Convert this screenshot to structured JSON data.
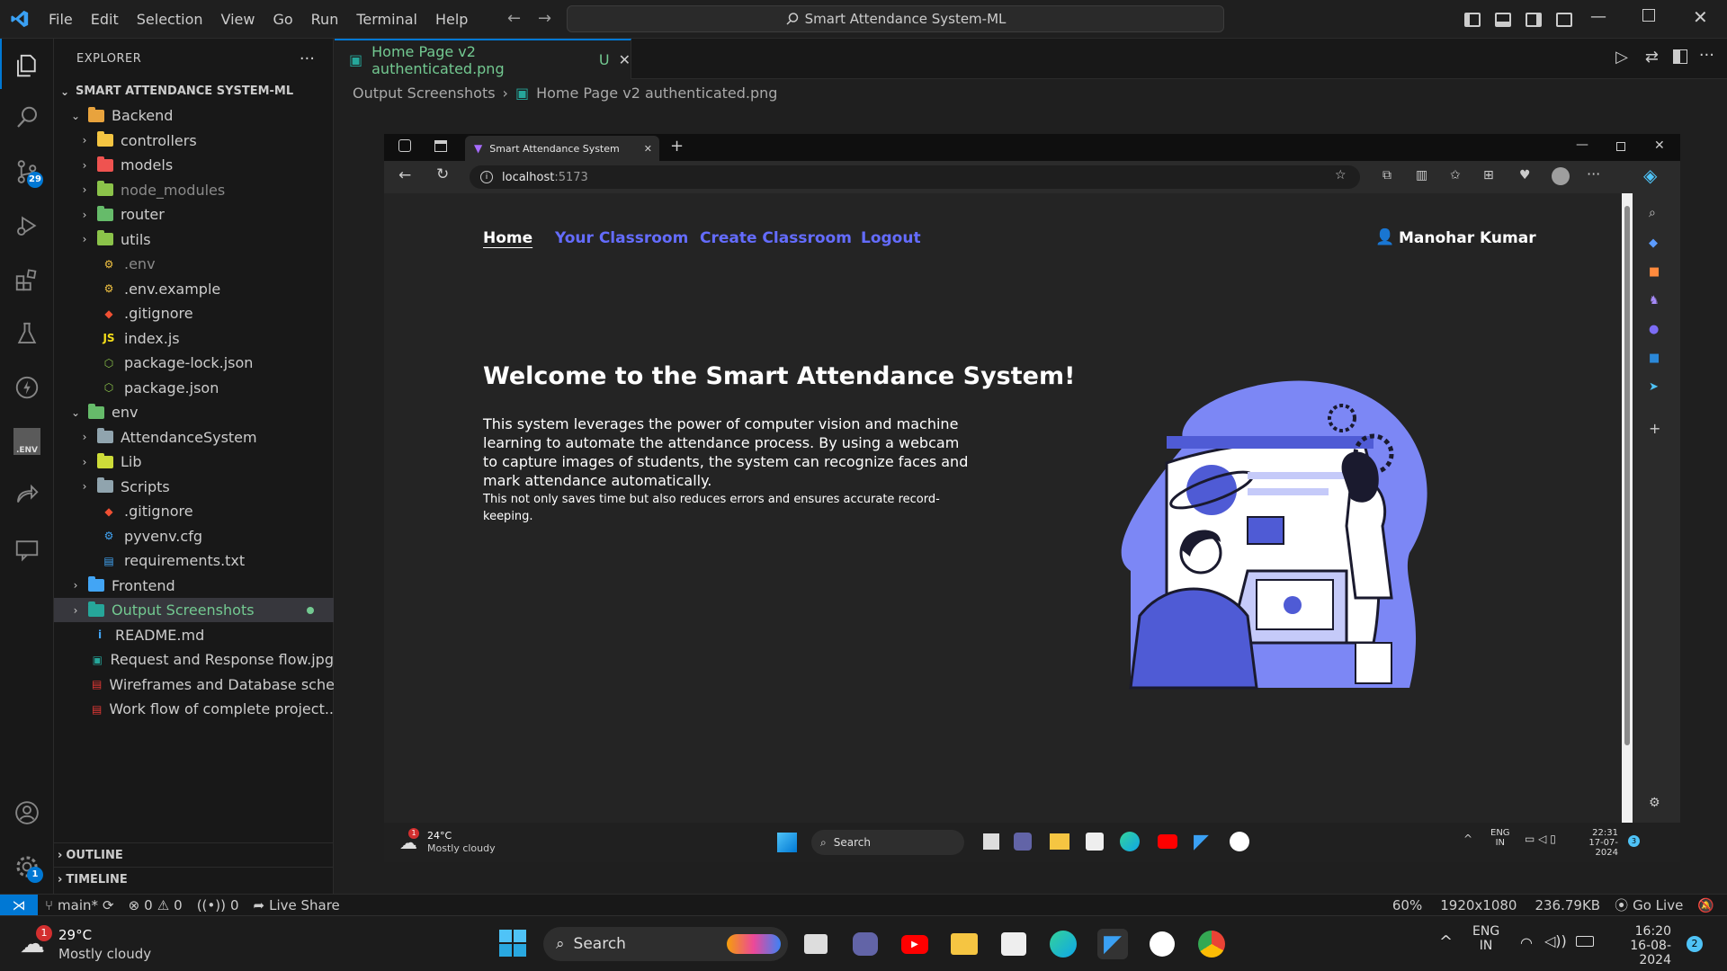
{
  "titlebar": {
    "menus": [
      "File",
      "Edit",
      "Selection",
      "View",
      "Go",
      "Run",
      "Terminal",
      "Help"
    ],
    "search_text": "Smart Attendance System-ML"
  },
  "activity": {
    "source_control_badge": "29",
    "accounts_badge": "1"
  },
  "sidebar": {
    "header": "EXPLORER",
    "root": "SMART ATTENDANCE SYSTEM-ML",
    "items": [
      {
        "label": "Backend",
        "level": 1,
        "kind": "folder-open",
        "color": "#e8a33d"
      },
      {
        "label": "controllers",
        "level": 2,
        "kind": "folder",
        "color": "#f5c542"
      },
      {
        "label": "models",
        "level": 2,
        "kind": "folder",
        "color": "#ef5350"
      },
      {
        "label": "node_modules",
        "level": 2,
        "kind": "folder",
        "color": "#8bc34a",
        "dim": true
      },
      {
        "label": "router",
        "level": 2,
        "kind": "folder",
        "color": "#66bb6a"
      },
      {
        "label": "utils",
        "level": 2,
        "kind": "folder",
        "color": "#8bc34a"
      },
      {
        "label": ".env",
        "level": 2,
        "kind": "file",
        "glyph": "⚙",
        "color": "#f5c542",
        "dim": true
      },
      {
        "label": ".env.example",
        "level": 2,
        "kind": "file",
        "glyph": "⚙",
        "color": "#f5c542"
      },
      {
        "label": ".gitignore",
        "level": 2,
        "kind": "file",
        "glyph": "◆",
        "color": "#f05033"
      },
      {
        "label": "index.js",
        "level": 2,
        "kind": "file",
        "glyph": "JS",
        "color": "#f5de19"
      },
      {
        "label": "package-lock.json",
        "level": 2,
        "kind": "file",
        "glyph": "⬡",
        "color": "#8bc34a"
      },
      {
        "label": "package.json",
        "level": 2,
        "kind": "file",
        "glyph": "⬡",
        "color": "#8bc34a"
      },
      {
        "label": "env",
        "level": 1,
        "kind": "folder-open",
        "color": "#66bb6a"
      },
      {
        "label": "AttendanceSystem",
        "level": 2,
        "kind": "folder",
        "color": "#90a4ae"
      },
      {
        "label": "Lib",
        "level": 2,
        "kind": "folder",
        "color": "#cddc39"
      },
      {
        "label": "Scripts",
        "level": 2,
        "kind": "folder",
        "color": "#90a4ae"
      },
      {
        "label": ".gitignore",
        "level": 2,
        "kind": "file",
        "glyph": "◆",
        "color": "#f05033"
      },
      {
        "label": "pyvenv.cfg",
        "level": 2,
        "kind": "file",
        "glyph": "⚙",
        "color": "#42a5f5"
      },
      {
        "label": "requirements.txt",
        "level": 2,
        "kind": "file",
        "glyph": "▤",
        "color": "#42a5f5"
      },
      {
        "label": "Frontend",
        "level": 1,
        "kind": "folder",
        "color": "#42a5f5"
      },
      {
        "label": "Output Screenshots",
        "level": 1,
        "kind": "folder",
        "color": "#26a69a",
        "selected": true
      },
      {
        "label": "README.md",
        "level": 1,
        "kind": "file",
        "glyph": "i",
        "color": "#42a5f5"
      },
      {
        "label": "Request and Response flow.jpg",
        "level": 1,
        "kind": "file",
        "glyph": "▣",
        "color": "#26a69a"
      },
      {
        "label": "Wireframes and Database sche...",
        "level": 1,
        "kind": "file",
        "glyph": "▤",
        "color": "#e53935"
      },
      {
        "label": "Work flow of complete project....",
        "level": 1,
        "kind": "file",
        "glyph": "▤",
        "color": "#e53935"
      }
    ],
    "outline": "OUTLINE",
    "timeline": "TIMELINE"
  },
  "editor": {
    "tab_label": "Home Page v2 authenticated.png",
    "tab_status": "U",
    "breadcrumb": [
      "Output Screenshots",
      "Home Page v2 authenticated.png"
    ]
  },
  "screenshot": {
    "browser_tab": "Smart Attendance System",
    "url_host": "localhost",
    "url_port": ":5173",
    "nav": [
      "Home",
      "Your Classroom",
      "Create Classroom",
      "Logout"
    ],
    "user_name": "Manohar Kumar",
    "heading": "Welcome to the Smart Attendance System!",
    "para1": "This system leverages the power of computer vision and machine learning to automate the attendance process. By using a webcam to capture images of students, the system can recognize faces and mark attendance automatically.",
    "para2": "This not only saves time but also reduces errors and ensures accurate record-keeping.",
    "weather_temp": "24°C",
    "weather_desc": "Mostly cloudy",
    "search": "Search",
    "lang1": "ENG",
    "lang2": "IN",
    "time": "22:31",
    "date": "17-07-2024",
    "notif_badge": "3",
    "weather_badge": "1"
  },
  "statusbar": {
    "branch": "main*",
    "errors": "0",
    "warnings": "0",
    "ports": "0",
    "live_share": "Live Share",
    "zoom": "60%",
    "dimensions": "1920x1080",
    "size": "236.79KB",
    "go_live": "Go Live"
  },
  "taskbar": {
    "weather_temp": "29°C",
    "weather_desc": "Mostly cloudy",
    "weather_badge": "1",
    "search": "Search",
    "lang1": "ENG",
    "lang2": "IN",
    "time": "16:20",
    "date": "16-08-2024",
    "notif_badge": "2"
  }
}
